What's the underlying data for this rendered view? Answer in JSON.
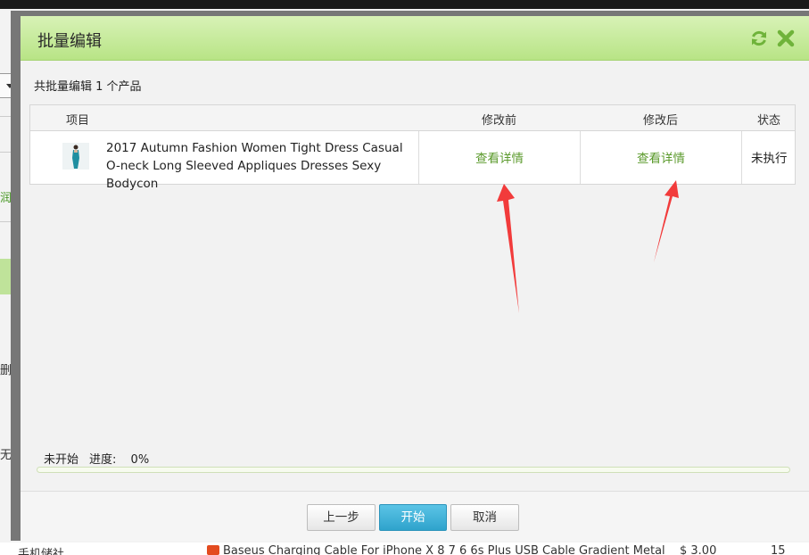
{
  "background": {
    "left_fragments": [
      "润区",
      "删",
      "无饱"
    ],
    "bottom_row": {
      "left_text": "手机储社",
      "product_text": "Baseus Charging Cable For iPhone X 8 7 6 6s Plus USB Cable Gradient Metal",
      "price_text": "$ 3.00",
      "qty_text": "15"
    }
  },
  "dialog": {
    "title": "批量编辑",
    "refresh_icon": "refresh-icon",
    "close_icon": "close-icon",
    "summary": "共批量编辑 1 个产品",
    "table": {
      "headers": {
        "item": "项目",
        "before": "修改前",
        "after": "修改后",
        "status": "状态"
      },
      "rows": [
        {
          "product_name": "2017 Autumn Fashion Women Tight Dress Casual O-neck Long Sleeved Appliques Dresses Sexy Bodycon",
          "before_link": "查看详情",
          "after_link": "查看详情",
          "status": "未执行"
        }
      ]
    },
    "progress": {
      "state": "未开始",
      "label": "进度:",
      "value_text": "0%",
      "value": 0
    },
    "buttons": {
      "prev": "上一步",
      "start": "开始",
      "cancel": "取消"
    }
  },
  "colors": {
    "header_green": "#b8e486",
    "link_green": "#5b9a2c",
    "primary_blue": "#2fa3cc",
    "arrow_red": "#f23b3b"
  }
}
